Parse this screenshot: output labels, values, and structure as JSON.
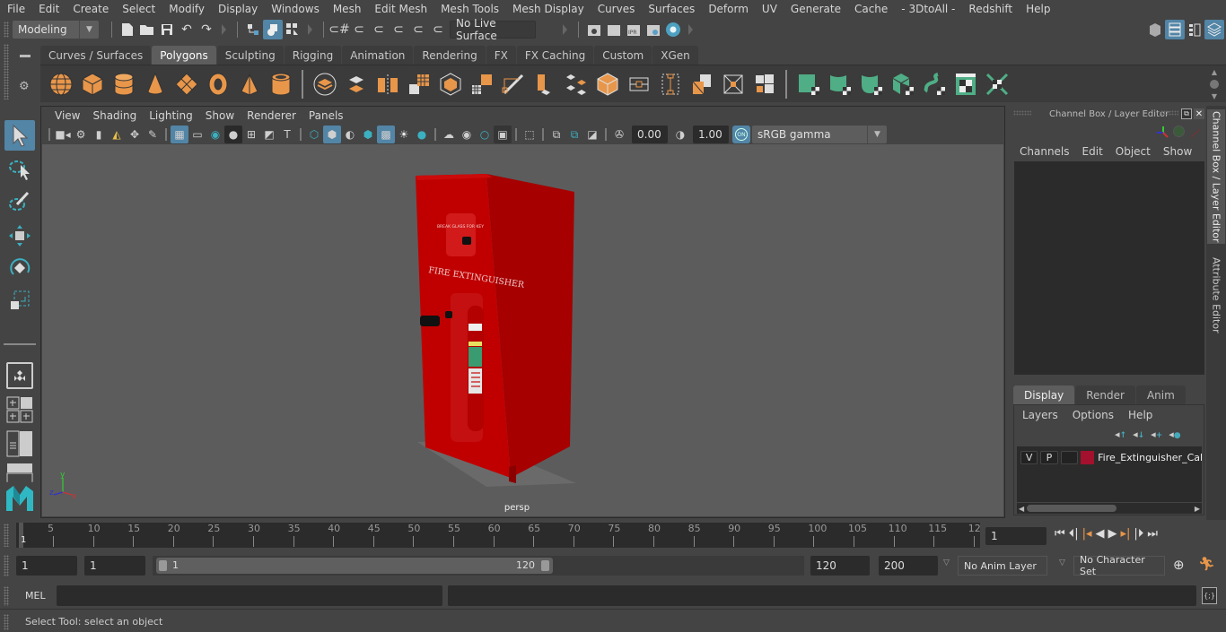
{
  "menubar": {
    "items": [
      "File",
      "Edit",
      "Create",
      "Select",
      "Modify",
      "Display",
      "Windows",
      "Mesh",
      "Edit Mesh",
      "Mesh Tools",
      "Mesh Display",
      "Curves",
      "Surfaces",
      "Deform",
      "UV",
      "Generate",
      "Cache",
      "- 3DtoAll -",
      "Redshift",
      "Help"
    ]
  },
  "statusline": {
    "workspace_mode": "Modeling",
    "live_surface": "No Live Surface"
  },
  "shelf": {
    "tabs": [
      "Curves / Surfaces",
      "Polygons",
      "Sculpting",
      "Rigging",
      "Animation",
      "Rendering",
      "FX",
      "FX Caching",
      "Custom",
      "XGen"
    ],
    "active_tab": "Polygons",
    "icons_group1": [
      "poly-sphere-icon",
      "poly-cube-icon",
      "poly-cylinder-icon",
      "poly-cone-icon",
      "poly-plane-icon",
      "poly-torus-icon",
      "poly-pyramid-icon",
      "poly-pipe-icon"
    ],
    "icons_group2": [
      "combine-icon",
      "separate-icon",
      "mirror-icon",
      "smooth-icon",
      "bevel-icon",
      "extrude-icon",
      "multi-cut-icon",
      "bridge-icon",
      "fill-hole-icon",
      "triangulate-icon",
      "center-pivot-icon",
      "freeze-transform-icon",
      "delete-history-icon",
      "bounding-box-icon",
      "quad-draw-icon"
    ],
    "icons_group3": [
      "planar-uv-icon",
      "cylindrical-uv-icon",
      "spherical-uv-icon",
      "automatic-uv-icon",
      "unfold-uv-icon",
      "uv-editor-icon",
      "layout-uv-icon"
    ]
  },
  "viewport": {
    "menu": [
      "View",
      "Shading",
      "Lighting",
      "Show",
      "Renderer",
      "Panels"
    ],
    "exposure": "0.00",
    "gamma": "1.00",
    "color_management": "ON",
    "color_space": "sRGB gamma",
    "camera_label": "persp",
    "object_label": "FIRE EXTINGUISHER",
    "sign_label": "BREAK GLASS FOR KEY",
    "axis": {
      "x": "x",
      "y": "y",
      "z": "z"
    }
  },
  "channel_box": {
    "title": "Channel Box / Layer Editor",
    "menu": [
      "Channels",
      "Edit",
      "Object",
      "Show"
    ]
  },
  "layer_editor": {
    "tabs": [
      "Display",
      "Render",
      "Anim"
    ],
    "active_tab": "Display",
    "menu": [
      "Layers",
      "Options",
      "Help"
    ],
    "layers": [
      {
        "visible": "V",
        "playback": "P",
        "color": "#a3112e",
        "name": "Fire_Extinguisher_Cab"
      }
    ]
  },
  "side_tabs": [
    "Channel Box / Layer Editor",
    "Attribute Editor"
  ],
  "timeline": {
    "ticks": [
      "5",
      "10",
      "15",
      "20",
      "25",
      "30",
      "35",
      "40",
      "45",
      "50",
      "55",
      "60",
      "65",
      "70",
      "75",
      "80",
      "85",
      "90",
      "95",
      "100",
      "105",
      "110",
      "115",
      "12"
    ],
    "current_frame_marker": "1",
    "current_frame": "1"
  },
  "range": {
    "start_time": "1",
    "playback_start": "1",
    "slider_start": "1",
    "slider_end": "120",
    "playback_end": "120",
    "end_time": "200",
    "anim_layer": "No Anim Layer",
    "character_set": "No Character Set"
  },
  "command_line": {
    "label": "MEL"
  },
  "help_line": {
    "text": "Select Tool: select an object"
  }
}
